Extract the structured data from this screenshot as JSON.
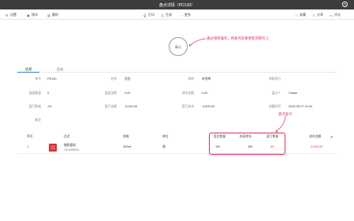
{
  "window": {
    "title": "盘点详情（PD130）",
    "close_glyph": "×"
  },
  "toolbar": {
    "left": [
      {
        "label": "设置",
        "icon": "settings-icon",
        "glyph": "⚙"
      },
      {
        "label": "保存",
        "icon": "save-icon",
        "glyph": "▣"
      },
      {
        "label": "删除",
        "icon": "delete-icon",
        "glyph": "▥"
      }
    ],
    "center": [
      {
        "label": "打印",
        "icon": "print-icon",
        "glyph": "⎙"
      },
      {
        "label": "生成",
        "icon": "generate-icon",
        "glyph": "◫"
      },
      {
        "label": "更多",
        "icon": "more-icon",
        "glyph": "⋯"
      }
    ],
    "right": [
      {
        "label": "收藏",
        "icon": "star-icon",
        "glyph": "☆"
      },
      {
        "label": "分享",
        "icon": "share-icon",
        "glyph": "⇪"
      },
      {
        "label": "评论",
        "icon": "comment-icon",
        "glyph": "▭"
      }
    ]
  },
  "stamp": {
    "label": "确认"
  },
  "annotations": {
    "stamp_note": "通过领库操作，将盘点结果更新到库存上",
    "table_note": "盘点盈亏"
  },
  "tabs": [
    {
      "label": "信息",
      "active": true
    },
    {
      "label": "日志",
      "active": false
    }
  ],
  "form": {
    "row1": [
      {
        "label": "单号",
        "value": "PD130"
      },
      {
        "label": "仓库",
        "value": "总仓"
      },
      {
        "label": "领库",
        "value": "未领库"
      },
      {
        "label": "领取执行",
        "value": ""
      }
    ],
    "row2": [
      {
        "label": "盘盈数量",
        "value": "5"
      },
      {
        "label": "盘盈金额",
        "value": "0.00"
      },
      {
        "label": "成本金额",
        "value": "0.00"
      },
      {
        "label": "盘点人",
        "value": "Chase"
      }
    ],
    "row3": [
      {
        "label": "盘亏数量",
        "value": "-50"
      },
      {
        "label": "盘亏金额",
        "value": "-5,000.00"
      },
      {
        "label": "盘亏成本",
        "value": "-3,500.00"
      },
      {
        "label": "创建时间",
        "value": "2023-05-27 10:04"
      }
    ],
    "row4": [
      {
        "label": "备注",
        "value": ""
      }
    ]
  },
  "table": {
    "headers": {
      "index": "序号",
      "name": "品名",
      "spec": "规格",
      "unit": "单位",
      "counted": "盘点数量",
      "stock": "账面库存",
      "diff": "盈亏数量",
      "cost": "成本金额"
    },
    "settings_glyph": "⚙",
    "rows": [
      {
        "index": "1",
        "name": "福袋面料",
        "code": "CH-000001",
        "spec": "300ml",
        "unit": "瓶",
        "counted": "100",
        "stock": "150",
        "diff": "-50",
        "cost": "-3,500.00"
      }
    ]
  },
  "colors": {
    "accent": "#2a7be4",
    "annotation": "#e02a50",
    "titlebar": "#3d3d3d"
  }
}
